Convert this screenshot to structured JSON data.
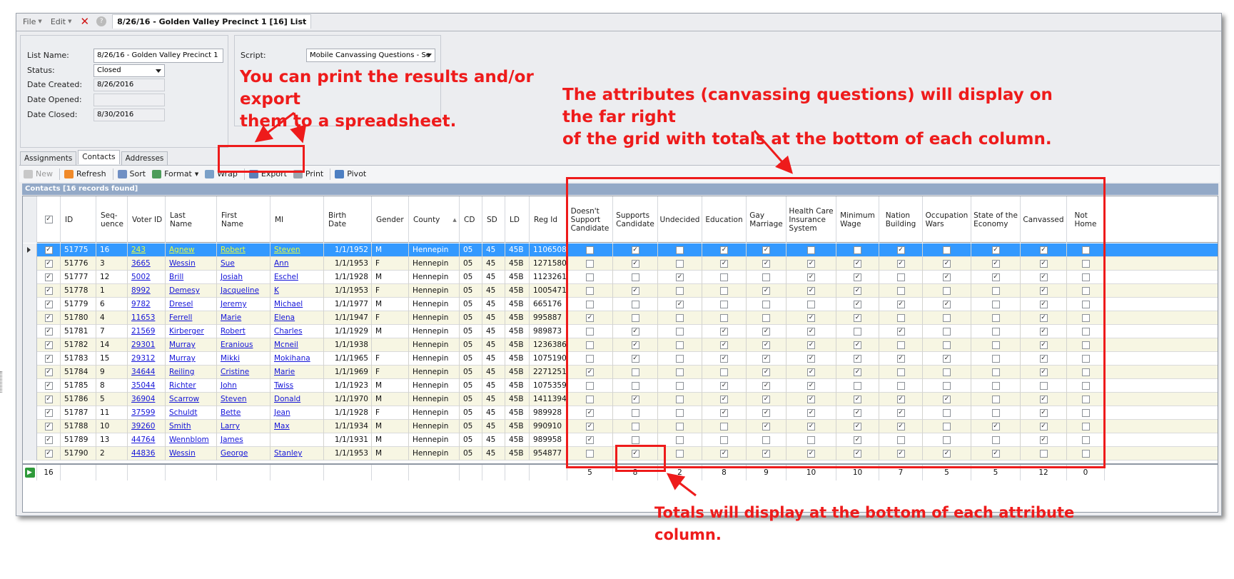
{
  "menu": {
    "file": "File",
    "edit": "Edit",
    "window_title": "8/26/16 - Golden Valley Precinct 1 [16] List"
  },
  "form": {
    "list_name_label": "List Name:",
    "list_name": "8/26/16 - Golden Valley Precinct 1",
    "status_label": "Status:",
    "status": "Closed",
    "created_label": "Date Created:",
    "created": "8/26/2016",
    "opened_label": "Date Opened:",
    "opened": "",
    "closed_label": "Date Closed:",
    "closed": "8/30/2016",
    "script_label": "Script:",
    "script": "Mobile Canvassing Questions - Sc"
  },
  "tabs": [
    "Assignments",
    "Contacts",
    "Addresses"
  ],
  "toolbar": {
    "new": "New",
    "refresh": "Refresh",
    "sort": "Sort",
    "format": "Format",
    "wrap": "Wrap",
    "export": "Export",
    "print": "Print",
    "pivot": "Pivot"
  },
  "grid_title": "Contacts [16 records found]",
  "columns": [
    "ID",
    "Seq-\nuence",
    "Voter ID",
    "Last\nName",
    "First\nName",
    "MI",
    "Birth\nDate",
    "Gender",
    "County",
    "CD",
    "SD",
    "LD",
    "Reg Id"
  ],
  "attr_columns": [
    "Doesn't\nSupport\nCandidate",
    "Supports\nCandidate",
    "Undecided",
    "Education",
    "Gay\nMarriage",
    "Health  Care\nInsurance\nSystem",
    "Minimum\nWage",
    "Nation\nBuilding",
    "Occupation\nWars",
    "State of the\nEconomy",
    "Canvassed",
    "Not\nHome"
  ],
  "rows": [
    {
      "id": "51775",
      "seq": "16",
      "voter": "243",
      "last": "Agnew",
      "first": "Robert",
      "mi": "Steven",
      "birth": "1/1/1952",
      "gender": "M",
      "county": "Hennepin",
      "cd": "05",
      "sd": "45",
      "ld": "45B",
      "reg": "1106508",
      "attrs": [
        0,
        1,
        0,
        1,
        1,
        0,
        0,
        1,
        0,
        1,
        1,
        0
      ]
    },
    {
      "id": "51776",
      "seq": "3",
      "voter": "3665",
      "last": "Wessin",
      "first": "Sue",
      "mi": "Ann",
      "birth": "1/1/1953",
      "gender": "F",
      "county": "Hennepin",
      "cd": "05",
      "sd": "45",
      "ld": "45B",
      "reg": "1271580",
      "attrs": [
        0,
        1,
        0,
        1,
        1,
        1,
        1,
        1,
        1,
        1,
        1,
        0
      ]
    },
    {
      "id": "51777",
      "seq": "12",
      "voter": "5002",
      "last": "Brill",
      "first": "Josiah",
      "mi": "Eschel",
      "birth": "1/1/1928",
      "gender": "M",
      "county": "Hennepin",
      "cd": "05",
      "sd": "45",
      "ld": "45B",
      "reg": "1123261",
      "attrs": [
        0,
        0,
        1,
        0,
        0,
        1,
        1,
        0,
        1,
        1,
        1,
        0
      ]
    },
    {
      "id": "51778",
      "seq": "1",
      "voter": "8992",
      "last": "Demesy",
      "first": "Jacqueline",
      "mi": "K",
      "birth": "1/1/1953",
      "gender": "F",
      "county": "Hennepin",
      "cd": "05",
      "sd": "45",
      "ld": "45B",
      "reg": "1005471",
      "attrs": [
        0,
        1,
        0,
        0,
        1,
        1,
        1,
        0,
        0,
        0,
        1,
        0
      ]
    },
    {
      "id": "51779",
      "seq": "6",
      "voter": "9782",
      "last": "Dresel",
      "first": "Jeremy",
      "mi": "Michael",
      "birth": "1/1/1977",
      "gender": "M",
      "county": "Hennepin",
      "cd": "05",
      "sd": "45",
      "ld": "45B",
      "reg": "665176",
      "attrs": [
        0,
        0,
        1,
        0,
        0,
        0,
        1,
        1,
        1,
        0,
        1,
        0
      ]
    },
    {
      "id": "51780",
      "seq": "4",
      "voter": "11653",
      "last": "Ferrell",
      "first": "Marie",
      "mi": "Elena",
      "birth": "1/1/1947",
      "gender": "F",
      "county": "Hennepin",
      "cd": "05",
      "sd": "45",
      "ld": "45B",
      "reg": "995887",
      "attrs": [
        1,
        0,
        0,
        0,
        0,
        1,
        1,
        0,
        0,
        0,
        1,
        0
      ]
    },
    {
      "id": "51781",
      "seq": "7",
      "voter": "21569",
      "last": "Kirberger",
      "first": "Robert",
      "mi": "Charles",
      "birth": "1/1/1929",
      "gender": "M",
      "county": "Hennepin",
      "cd": "05",
      "sd": "45",
      "ld": "45B",
      "reg": "989873",
      "attrs": [
        0,
        1,
        0,
        1,
        1,
        1,
        0,
        1,
        0,
        0,
        1,
        0
      ]
    },
    {
      "id": "51782",
      "seq": "14",
      "voter": "29301",
      "last": "Murray",
      "first": "Eranious",
      "mi": "Mcneil",
      "birth": "1/1/1938",
      "gender": "",
      "county": "Hennepin",
      "cd": "05",
      "sd": "45",
      "ld": "45B",
      "reg": "1236386",
      "attrs": [
        0,
        1,
        0,
        1,
        1,
        1,
        1,
        0,
        0,
        0,
        1,
        0
      ]
    },
    {
      "id": "51783",
      "seq": "15",
      "voter": "29312",
      "last": "Murray",
      "first": "Mikki",
      "mi": "Mokihana",
      "birth": "1/1/1965",
      "gender": "F",
      "county": "Hennepin",
      "cd": "05",
      "sd": "45",
      "ld": "45B",
      "reg": "1075190",
      "attrs": [
        0,
        1,
        0,
        1,
        1,
        1,
        1,
        1,
        1,
        0,
        1,
        0
      ]
    },
    {
      "id": "51784",
      "seq": "9",
      "voter": "34644",
      "last": "Reiling",
      "first": "Cristine",
      "mi": "Marie",
      "birth": "1/1/1969",
      "gender": "F",
      "county": "Hennepin",
      "cd": "05",
      "sd": "45",
      "ld": "45B",
      "reg": "2271251",
      "attrs": [
        1,
        0,
        0,
        0,
        1,
        1,
        1,
        0,
        0,
        0,
        1,
        0
      ]
    },
    {
      "id": "51785",
      "seq": "8",
      "voter": "35044",
      "last": "Richter",
      "first": "John",
      "mi": "Twiss",
      "birth": "1/1/1923",
      "gender": "M",
      "county": "Hennepin",
      "cd": "05",
      "sd": "45",
      "ld": "45B",
      "reg": "1075359",
      "attrs": [
        0,
        0,
        0,
        1,
        1,
        1,
        0,
        0,
        0,
        0,
        0,
        0
      ]
    },
    {
      "id": "51786",
      "seq": "5",
      "voter": "36904",
      "last": "Scarrow",
      "first": "Steven",
      "mi": "Donald",
      "birth": "1/1/1970",
      "gender": "M",
      "county": "Hennepin",
      "cd": "05",
      "sd": "45",
      "ld": "45B",
      "reg": "1411394",
      "attrs": [
        0,
        1,
        0,
        1,
        1,
        1,
        1,
        1,
        1,
        0,
        1,
        0
      ]
    },
    {
      "id": "51787",
      "seq": "11",
      "voter": "37599",
      "last": "Schuldt",
      "first": "Bette",
      "mi": "Jean",
      "birth": "1/1/1928",
      "gender": "F",
      "county": "Hennepin",
      "cd": "05",
      "sd": "45",
      "ld": "45B",
      "reg": "989928",
      "attrs": [
        1,
        0,
        0,
        1,
        1,
        1,
        1,
        1,
        0,
        0,
        1,
        0
      ]
    },
    {
      "id": "51788",
      "seq": "10",
      "voter": "39260",
      "last": "Smith",
      "first": "Larry",
      "mi": "Max",
      "birth": "1/1/1934",
      "gender": "M",
      "county": "Hennepin",
      "cd": "05",
      "sd": "45",
      "ld": "45B",
      "reg": "990910",
      "attrs": [
        1,
        0,
        0,
        0,
        1,
        1,
        1,
        1,
        0,
        1,
        1,
        0
      ]
    },
    {
      "id": "51789",
      "seq": "13",
      "voter": "44764",
      "last": "Wennblom",
      "first": "James",
      "mi": "",
      "birth": "1/1/1931",
      "gender": "M",
      "county": "Hennepin",
      "cd": "05",
      "sd": "45",
      "ld": "45B",
      "reg": "989958",
      "attrs": [
        1,
        0,
        0,
        0,
        0,
        0,
        1,
        0,
        0,
        0,
        1,
        0
      ]
    },
    {
      "id": "51790",
      "seq": "2",
      "voter": "44836",
      "last": "Wessin",
      "first": "George",
      "mi": "Stanley",
      "birth": "1/1/1953",
      "gender": "M",
      "county": "Hennepin",
      "cd": "05",
      "sd": "45",
      "ld": "45B",
      "reg": "954877",
      "attrs": [
        0,
        1,
        0,
        1,
        1,
        1,
        1,
        1,
        1,
        1,
        0,
        0
      ]
    }
  ],
  "footer_count": "16",
  "totals": [
    "5",
    "8",
    "2",
    "8",
    "9",
    "10",
    "10",
    "7",
    "5",
    "5",
    "12",
    "0"
  ],
  "annotations": {
    "print": "You can print the results and/or export\nthem to a spreadsheet.",
    "attrs": "The attributes (canvassing questions) will display on the far right\nof the grid with totals at the bottom of each column.",
    "totals": "Totals will display at the bottom of each attribute column."
  }
}
